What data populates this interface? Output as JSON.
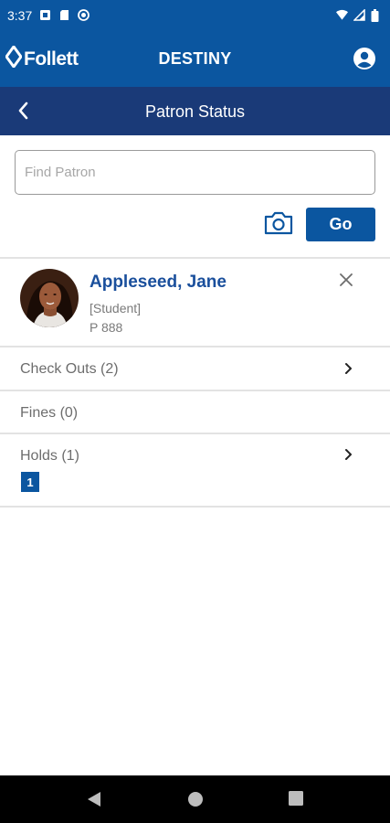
{
  "status_bar": {
    "time": "3:37"
  },
  "app_bar": {
    "brand": "Follett",
    "title": "DESTINY"
  },
  "page_header": {
    "title": "Patron Status"
  },
  "search": {
    "placeholder": "Find Patron",
    "value": "",
    "go_label": "Go"
  },
  "patron": {
    "name": "Appleseed, Jane",
    "type": "[Student]",
    "id": "P 888"
  },
  "rows": {
    "checkouts": "Check Outs (2)",
    "fines": "Fines (0)",
    "holds": "Holds (1)",
    "holds_badge": "1"
  },
  "icons": {
    "account": "account-circle-icon",
    "back": "chevron-left-icon",
    "camera": "camera-icon",
    "close": "close-icon",
    "chevron": "chevron-right-icon"
  },
  "colors": {
    "brand_blue": "#0b56a0",
    "header_navy": "#1a3a78",
    "name_blue": "#1a4f9c"
  }
}
